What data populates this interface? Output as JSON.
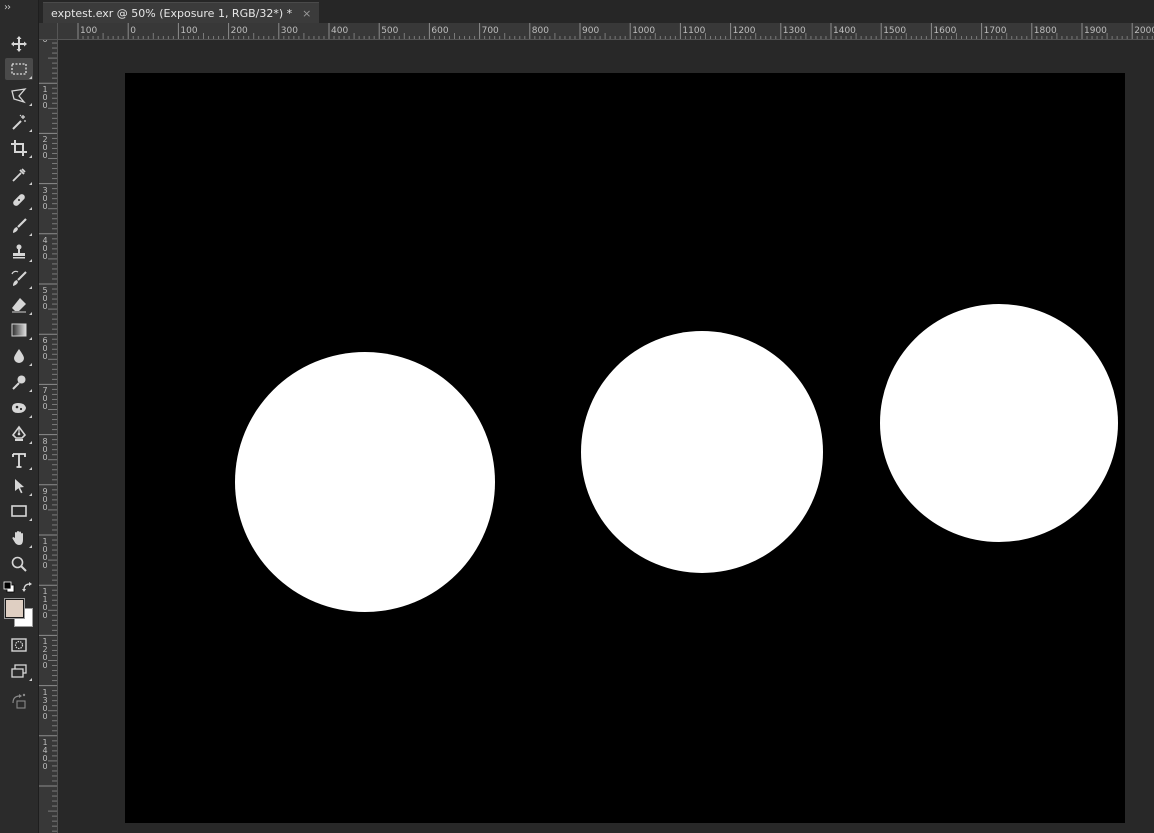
{
  "document_tab": {
    "title": "exptest.exr @ 50% (Exposure 1, RGB/32*) *",
    "close_glyph": "×"
  },
  "toolbar": {
    "collapse_glyph": "››",
    "active_tool": "rectangular-marquee",
    "tools": [
      "move-icon",
      "rectangular-marquee-icon",
      "polygonal-lasso-icon",
      "magic-wand-icon",
      "crop-icon",
      "eyedropper-icon",
      "spot-healing-icon",
      "brush-icon",
      "clone-stamp-icon",
      "history-brush-icon",
      "eraser-icon",
      "gradient-icon",
      "blur-icon",
      "dodge-icon",
      "sponge-icon",
      "pen-icon",
      "type-icon",
      "path-selection-icon",
      "rectangle-shape-icon",
      "hand-icon",
      "zoom-icon"
    ],
    "foreground_color": "#dfcfc2",
    "background_color": "#ffffff"
  },
  "rulers": {
    "top_labels": [
      "100",
      "0",
      "100",
      "200",
      "300",
      "400",
      "500",
      "600",
      "700",
      "800",
      "900",
      "1000",
      "1100",
      "1200",
      "1300",
      "1400",
      "1500",
      "1600",
      "1700",
      "1800",
      "1900",
      "2000"
    ],
    "left_labels": [
      "0",
      "100",
      "200",
      "300",
      "400",
      "500",
      "600",
      "700",
      "800",
      "900",
      "1000",
      "1100",
      "1200",
      "1300",
      "1400"
    ]
  },
  "canvas": {
    "background": "#000000",
    "shape_color": "#ffffff"
  }
}
